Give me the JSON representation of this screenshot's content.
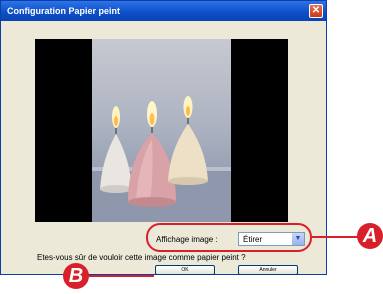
{
  "window": {
    "title": "Configuration Papier peint",
    "close_glyph": "✕"
  },
  "preview": {
    "image_alt": "candles wallpaper preview"
  },
  "display_option": {
    "label": "Affichage image :",
    "selected": "Étirer"
  },
  "question": "Etes-vous sûr de vouloir cette image comme papier peint ?",
  "buttons": {
    "ok": "OK",
    "cancel": "Annuler"
  },
  "callouts": {
    "a": "A",
    "b": "B"
  },
  "colors": {
    "callout": "#d8202a",
    "titlebar": "#0d50c8",
    "dialog_bg": "#ece9d8"
  },
  "icons": {
    "close": "close-icon",
    "dropdown": "chevron-down-icon"
  }
}
